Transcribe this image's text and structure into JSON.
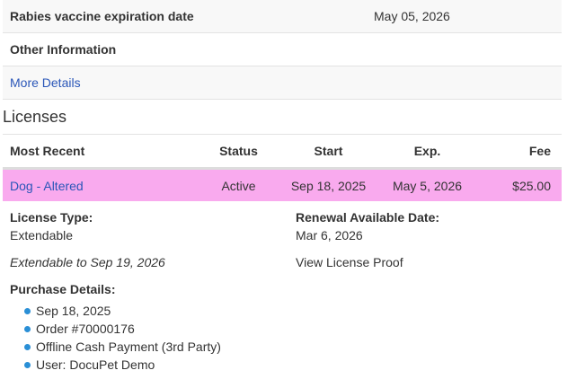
{
  "info_rows": [
    {
      "label": "Rabies vaccine expiration date",
      "value": "May 05, 2026"
    },
    {
      "label": "Other Information",
      "value": ""
    },
    {
      "link": "More Details"
    }
  ],
  "licenses": {
    "title": "Licenses",
    "columns": [
      "Most Recent",
      "Status",
      "Start",
      "Exp.",
      "Fee"
    ],
    "row": {
      "name": "Dog - Altered",
      "status": "Active",
      "start": "Sep 18, 2025",
      "exp": "May 5, 2026",
      "fee": "$25.00",
      "highlight_color": "#f9aaee"
    }
  },
  "details": {
    "license_type_label": "License Type:",
    "license_type_value": "Extendable",
    "renewal_label": "Renewal Available Date:",
    "renewal_value": "Mar 6, 2026",
    "extendable_note": "Extendable to Sep 19, 2026",
    "view_proof_link": "View License Proof",
    "purchase_label": "Purchase Details:",
    "purchase_items": [
      "Sep 18, 2025",
      "Order #70000176",
      "Offline Cash Payment (3rd Party)",
      "User: DocuPet Demo"
    ]
  },
  "colors": {
    "link": "#2a56b8",
    "bullet": "#2a8fd6"
  }
}
